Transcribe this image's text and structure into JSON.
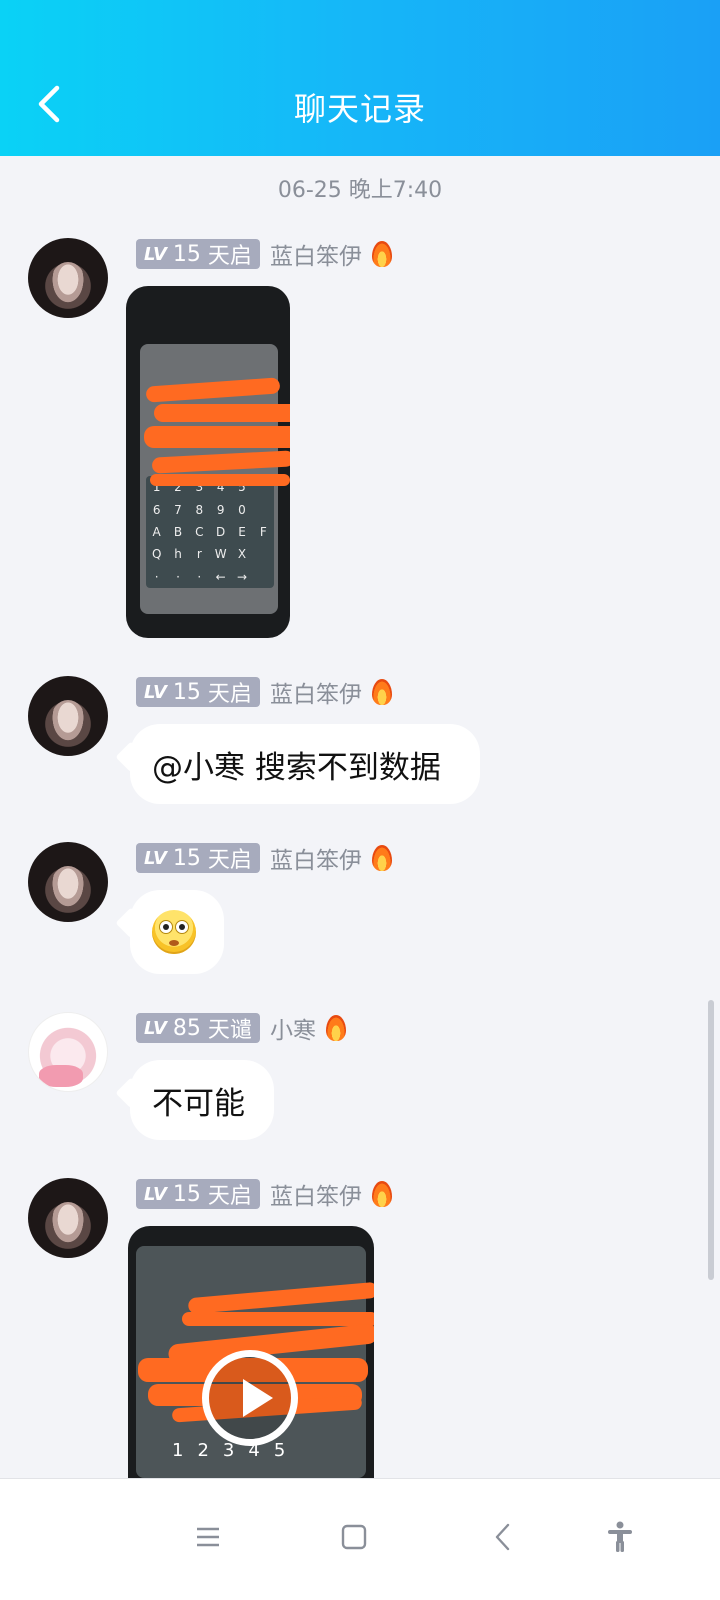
{
  "header": {
    "title": "聊天记录"
  },
  "timestamp": "06-25 晚上7:40",
  "messages": [
    {
      "level_prefix": "LV",
      "level_num": "15",
      "rank": "天启",
      "username": "蓝白笨伊",
      "type": "image"
    },
    {
      "level_prefix": "LV",
      "level_num": "15",
      "rank": "天启",
      "username": "蓝白笨伊",
      "type": "text",
      "text": "@小寒 搜索不到数据"
    },
    {
      "level_prefix": "LV",
      "level_num": "15",
      "rank": "天启",
      "username": "蓝白笨伊",
      "type": "emoji",
      "emoji": "flushed-face-icon"
    },
    {
      "level_prefix": "LV",
      "level_num": "85",
      "rank": "天谴",
      "username": "小寒",
      "type": "text",
      "text": "不可能"
    },
    {
      "level_prefix": "LV",
      "level_num": "15",
      "rank": "天启",
      "username": "蓝白笨伊",
      "type": "video"
    }
  ],
  "image_preview": {
    "keypad": [
      "1",
      "2",
      "3",
      "4",
      "5",
      "",
      "6",
      "7",
      "8",
      "9",
      "0",
      "",
      "A",
      "B",
      "C",
      "D",
      "E",
      "F",
      "Q",
      "h",
      "r",
      "W",
      "X",
      "",
      "·",
      "·",
      "·",
      "←",
      "→",
      ""
    ]
  },
  "video_preview": {
    "keys": [
      "1",
      "2",
      "3",
      "4",
      "5"
    ]
  },
  "colors": {
    "header_start": "#0ad2f6",
    "header_end": "#1aa0f6",
    "badge": "#a7abbd",
    "background": "#f3f4f8"
  },
  "navbar": {
    "icons": [
      "menu-icon",
      "home-icon",
      "back-icon",
      "accessibility-icon"
    ]
  }
}
